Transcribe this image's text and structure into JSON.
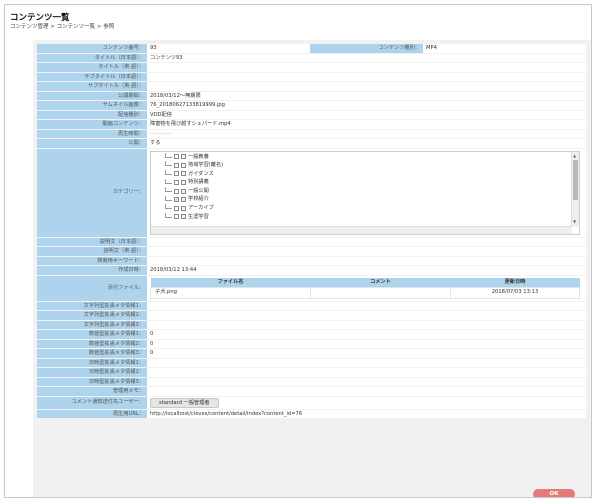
{
  "page": {
    "title": "コンテンツ一覧",
    "breadcrumb": "コンテンツ管理 > コンテンツ一覧 > 参照"
  },
  "fields": {
    "content_no": {
      "label": "コンテンツ番号：",
      "value": "93"
    },
    "content_type": {
      "label": "コンテンツ種別：",
      "value": "MP4"
    },
    "title_ja": {
      "label": "タイトル（日本語）：",
      "value": "コンテンツ93"
    },
    "title_en": {
      "label": "タイトル（英 語）：",
      "value": ""
    },
    "subtitle_ja": {
      "label": "サブタイトル（日本語）：",
      "value": ""
    },
    "subtitle_en": {
      "label": "サブタイトル（英 語）：",
      "value": ""
    },
    "publish_period": {
      "label": "公開期間：",
      "value": "2018/03/12～無期限"
    },
    "thumbnail": {
      "label": "サムネイル画像：",
      "value": "76_20180627133819999.jpg"
    },
    "distribution": {
      "label": "配信種別：",
      "value": "VOD配信"
    },
    "video": {
      "label": "動画コンテンツ：",
      "value": "障害物を飛び越すシェパード.mp4"
    },
    "playback_time": {
      "label": "再生時間：",
      "value": "--:--:--.---"
    },
    "public": {
      "label": "公開：",
      "value": "する"
    },
    "category": {
      "label": "カテゴリー："
    },
    "desc_ja": {
      "label": "説明文（日本語）：",
      "value": ""
    },
    "desc_en": {
      "label": "説明文（英 語）：",
      "value": ""
    },
    "search_keyword": {
      "label": "検索用キーワード：",
      "value": ""
    },
    "created_at": {
      "label": "作成日時：",
      "value": "2018/03/12 13:44"
    },
    "attachments": {
      "label": "添付ファイル："
    },
    "str_meta_1": {
      "label": "文字列型拡張メタ情報1：",
      "value": ""
    },
    "str_meta_2": {
      "label": "文字列型拡張メタ情報2：",
      "value": ""
    },
    "str_meta_3": {
      "label": "文字列型拡張メタ情報3：",
      "value": ""
    },
    "num_meta_1": {
      "label": "数値型拡張メタ情報1：",
      "value": "0"
    },
    "num_meta_2": {
      "label": "数値型拡張メタ情報2：",
      "value": "0"
    },
    "num_meta_3": {
      "label": "数値型拡張メタ情報3：",
      "value": "0"
    },
    "date_meta_1": {
      "label": "日時型拡張メタ情報1：",
      "value": ""
    },
    "date_meta_2": {
      "label": "日時型拡張メタ情報2：",
      "value": ""
    },
    "date_meta_3": {
      "label": "日時型拡張メタ情報3：",
      "value": ""
    },
    "admin_memo": {
      "label": "管理用メモ：",
      "value": ""
    },
    "comment_user": {
      "label": "コメント通知送付先ユーザー：",
      "value": "standard 一般管理者"
    },
    "play_url": {
      "label": "再生用URL：",
      "value": "http://localhost/cleves/content/detail/index?content_id=76"
    }
  },
  "categories": [
    {
      "label": "一般教養",
      "checked": false,
      "folder": true
    },
    {
      "label": "地域学習(離名)",
      "checked": false,
      "folder": false
    },
    {
      "label": "ガイダンス",
      "checked": false,
      "folder": true
    },
    {
      "label": "特別講義",
      "checked": false,
      "folder": false
    },
    {
      "label": "一般公開",
      "checked": false,
      "folder": false
    },
    {
      "label": "学校紹介",
      "checked": true,
      "folder": false
    },
    {
      "label": "アーカイブ",
      "checked": false,
      "folder": true
    },
    {
      "label": "生涯学習",
      "checked": false,
      "folder": false
    }
  ],
  "attachments_table": {
    "headers": {
      "filename": "ファイル名",
      "comment": "コメント",
      "updated": "更新日時"
    },
    "rows": [
      {
        "filename": "子犬.png",
        "comment": "",
        "updated": "2018/07/03 13:13"
      }
    ]
  },
  "buttons": {
    "ok": "OK"
  }
}
